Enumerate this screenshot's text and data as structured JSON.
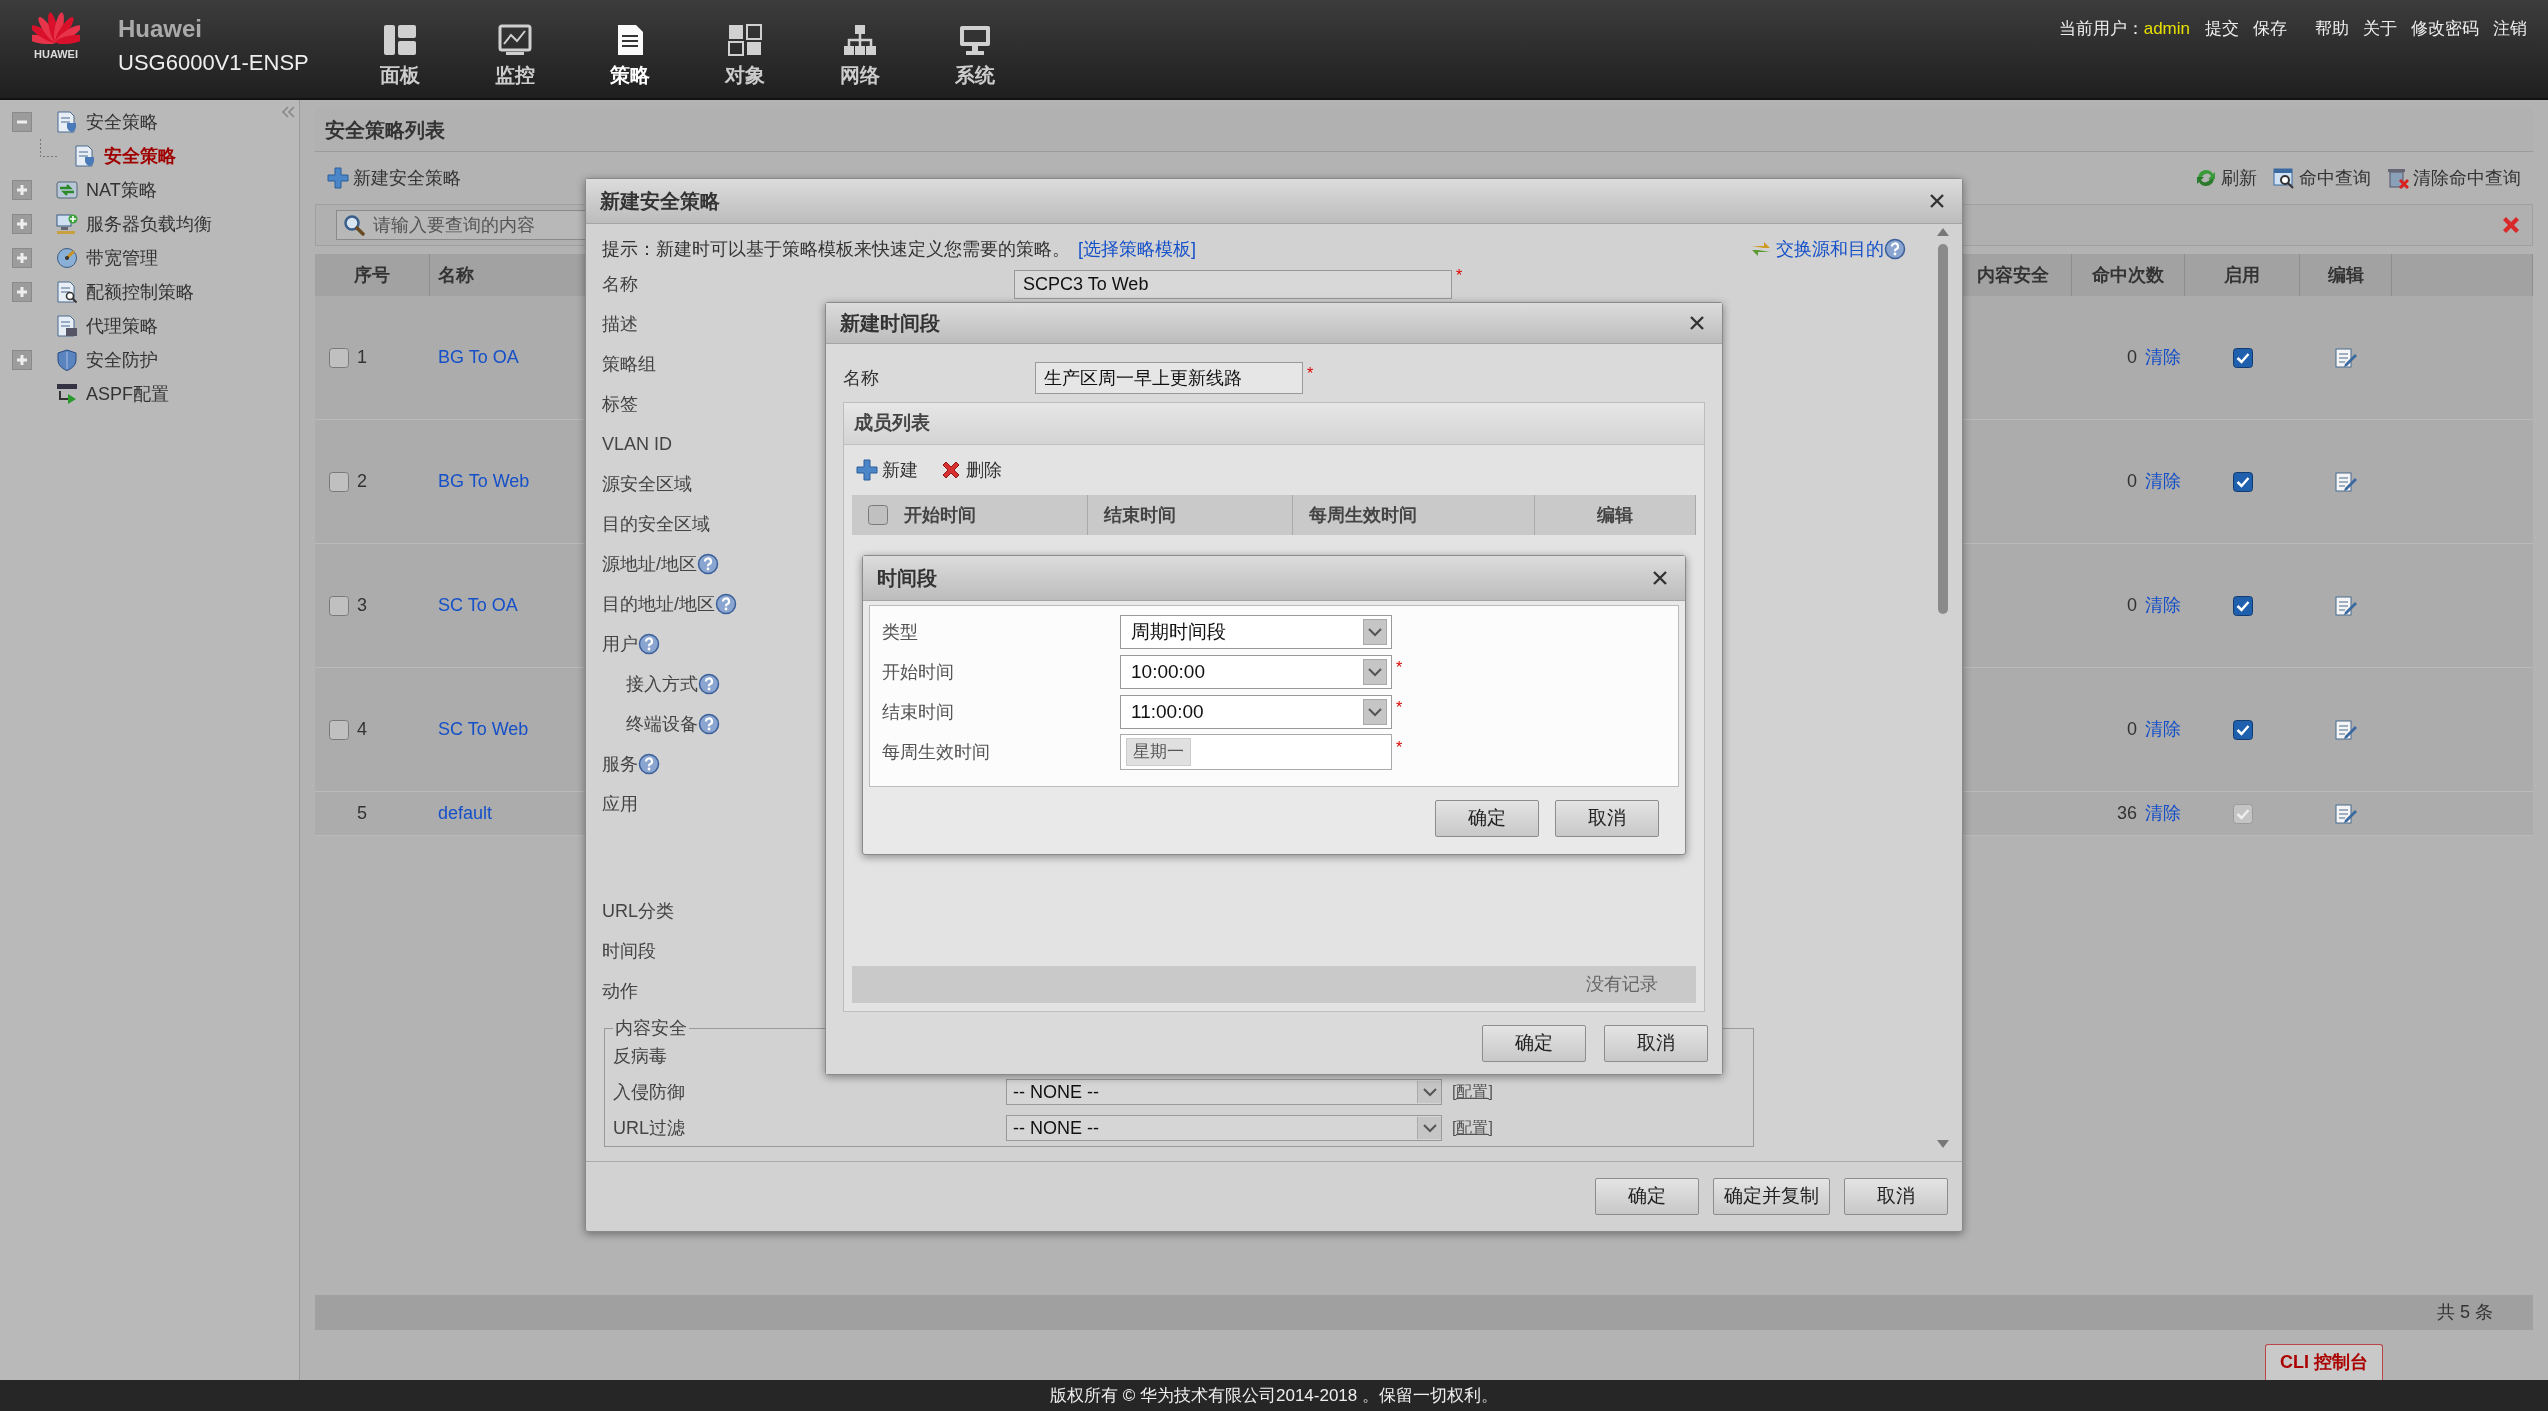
{
  "header": {
    "logo_text": "HUAWEI",
    "brand": "Huawei",
    "model": "USG6000V1-ENSP",
    "nav": [
      {
        "label": "面板",
        "selected": false
      },
      {
        "label": "监控",
        "selected": false
      },
      {
        "label": "策略",
        "selected": true
      },
      {
        "label": "对象",
        "selected": false
      },
      {
        "label": "网络",
        "selected": false
      },
      {
        "label": "系统",
        "selected": false
      }
    ],
    "user_label": "当前用户：",
    "user": "admin",
    "actions": [
      "提交",
      "保存",
      "帮助",
      "关于",
      "修改密码",
      "注销"
    ]
  },
  "sidebar": {
    "items": [
      {
        "label": "安全策略",
        "expanded": true,
        "selected": false,
        "children": [
          {
            "label": "安全策略",
            "selected": true
          }
        ]
      },
      {
        "label": "NAT策略",
        "expanded": false,
        "selected": false
      },
      {
        "label": "服务器负载均衡",
        "expanded": false,
        "selected": false
      },
      {
        "label": "带宽管理",
        "expanded": false,
        "selected": false
      },
      {
        "label": "配额控制策略",
        "expanded": false,
        "selected": false
      },
      {
        "label": "代理策略",
        "selected": false
      },
      {
        "label": "安全防护",
        "expanded": false,
        "selected": false
      },
      {
        "label": "ASPF配置",
        "selected": false
      }
    ]
  },
  "main": {
    "title": "安全策略列表",
    "toolbar": [
      {
        "label": "新建安全策略",
        "kind": "add"
      }
    ],
    "right_toolbar": [
      {
        "label": "刷新",
        "kind": "refresh"
      },
      {
        "label": "命中查询",
        "kind": "query"
      },
      {
        "label": "清除命中查询",
        "kind": "clear"
      }
    ],
    "search": {
      "placeholder": "请输入要查询的内容"
    },
    "table": {
      "columns_left": [
        "序号",
        "名称"
      ],
      "columns_right": [
        "内容安全",
        "命中次数",
        "启用",
        "编辑"
      ],
      "rows": [
        {
          "kind": "policy",
          "selected": false,
          "index": "1",
          "name": "BG To OA",
          "hits": "0",
          "clear": "清除",
          "enabled": true,
          "locked": false
        },
        {
          "kind": "policy",
          "selected": false,
          "index": "2",
          "name": "BG To Web",
          "hits": "0",
          "clear": "清除",
          "enabled": true,
          "locked": false
        },
        {
          "kind": "policy",
          "selected": false,
          "index": "3",
          "name": "SC To OA",
          "hits": "0",
          "clear": "清除",
          "enabled": true,
          "locked": false
        },
        {
          "kind": "policy",
          "selected": false,
          "index": "4",
          "name": "SC To Web",
          "hits": "0",
          "clear": "清除",
          "enabled": true,
          "locked": false
        },
        {
          "kind": "default",
          "index": "5",
          "name": "default",
          "hits": "36",
          "clear": "清除",
          "enabled": true,
          "locked": true
        }
      ]
    },
    "status": "共 5 条",
    "cli_tab": "CLI 控制台"
  },
  "copyright": "版权所有 © 华为技术有限公司2014-2018 。保留一切权利。",
  "policy_dialog": {
    "title": "新建安全策略",
    "hint": "提示：新建时可以基于策略模板来快速定义您需要的策略。",
    "template_link": "[选择策略模板]",
    "swap_link": "交换源和目的",
    "fields": [
      {
        "label": "名称",
        "help": false,
        "indent": false,
        "value": "SCPC3 To Web",
        "mark": "*"
      },
      {
        "label": "描述",
        "help": false,
        "indent": false
      },
      {
        "label": "策略组",
        "help": false,
        "indent": false
      },
      {
        "label": "标签",
        "help": false,
        "indent": false
      },
      {
        "label": "VLAN ID",
        "help": false,
        "indent": false
      },
      {
        "label": "源安全区域",
        "help": false,
        "indent": false
      },
      {
        "label": "目的安全区域",
        "help": false,
        "indent": false
      },
      {
        "label": "源地址/地区",
        "help": true,
        "indent": false
      },
      {
        "label": "目的地址/地区",
        "help": true,
        "indent": false
      },
      {
        "label": "用户",
        "help": true,
        "indent": false
      },
      {
        "label": "接入方式",
        "help": true,
        "indent": true
      },
      {
        "label": "终端设备",
        "help": true,
        "indent": true
      },
      {
        "label": "服务",
        "help": true,
        "indent": false
      },
      {
        "label": "应用",
        "help": false,
        "indent": false
      }
    ],
    "fields_lower": [
      {
        "label": "URL分类",
        "help": false,
        "indent": false
      },
      {
        "label": "时间段",
        "help": false,
        "indent": false
      },
      {
        "label": "动作",
        "help": false,
        "indent": false
      }
    ],
    "content_security": {
      "legend": "内容安全",
      "items": [
        {
          "label": "反病毒"
        },
        {
          "label": "入侵防御",
          "value": "-- NONE --",
          "link": "[配置]"
        },
        {
          "label": "URL过滤",
          "value": "-- NONE --",
          "link": "[配置]"
        }
      ]
    },
    "buttons": [
      "确定",
      "确定并复制",
      "取消"
    ]
  },
  "time_range_dialog": {
    "title": "新建时间段",
    "name_label": "名称",
    "name_value": "生产区周一早上更新线路",
    "mark": "*",
    "panel_title": "成员列表",
    "toolbar": [
      {
        "label": "新建",
        "kind": "add"
      },
      {
        "label": "删除",
        "kind": "delete"
      }
    ],
    "select_all": {
      "checked": false
    },
    "columns": [
      "开始时间",
      "结束时间",
      "每周生效时间",
      "编辑"
    ],
    "empty": "没有记录",
    "buttons": [
      "确定",
      "取消"
    ]
  },
  "period_dialog": {
    "title": "时间段",
    "fields": [
      {
        "kind": "select",
        "label": "类型",
        "value": "周期时间段"
      },
      {
        "kind": "select",
        "label": "开始时间",
        "value": "10:00:00",
        "mark": "*"
      },
      {
        "kind": "select",
        "label": "结束时间",
        "value": "11:00:00",
        "mark": "*"
      },
      {
        "kind": "tags",
        "label": "每周生效时间",
        "tags": [
          "星期一"
        ],
        "mark": "*"
      }
    ],
    "buttons": [
      "确定",
      "取消"
    ]
  }
}
